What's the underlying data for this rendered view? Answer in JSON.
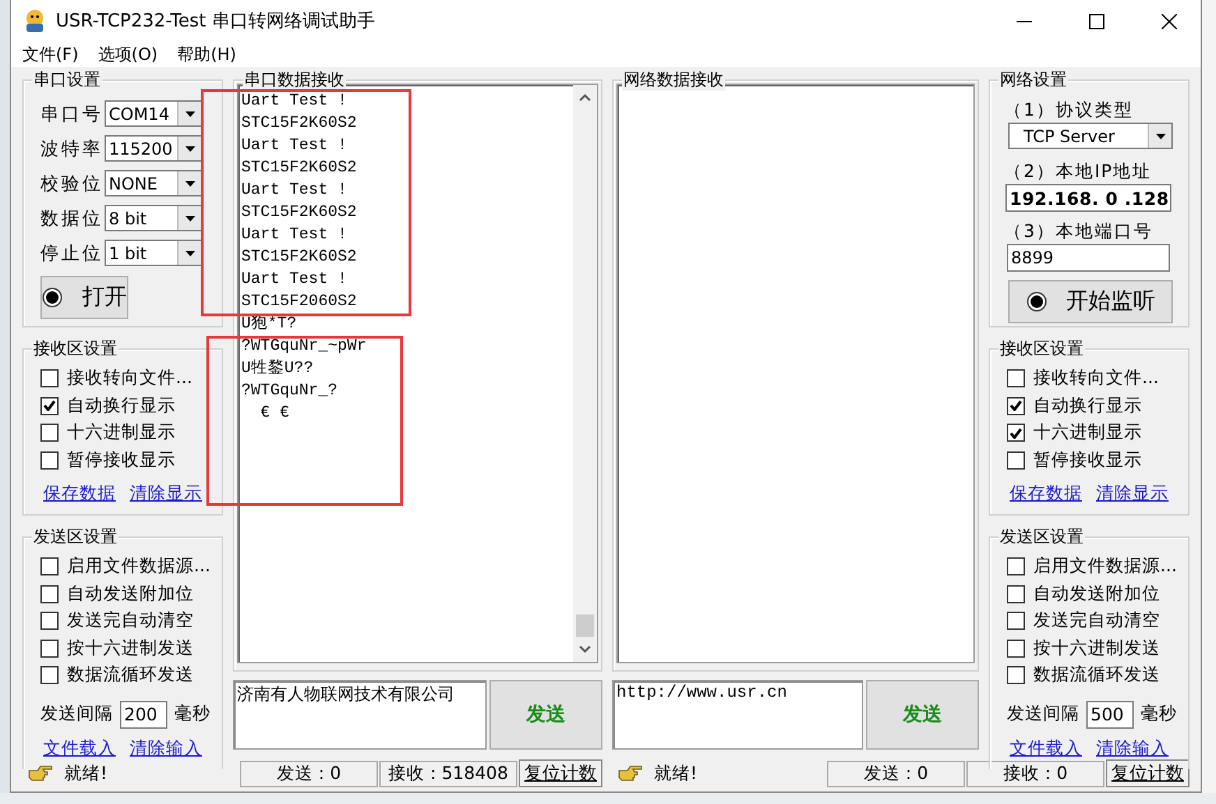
{
  "window": {
    "title": "USR-TCP232-Test 串口转网络调试助手"
  },
  "menu": [
    "文件(F)",
    "选项(O)",
    "帮助(H)"
  ],
  "serial_settings": {
    "title": "串口设置",
    "fields": [
      {
        "label": "串口号",
        "value": "COM14"
      },
      {
        "label": "波特率",
        "value": "115200"
      },
      {
        "label": "校验位",
        "value": "NONE"
      },
      {
        "label": "数据位",
        "value": "8 bit"
      },
      {
        "label": "停止位",
        "value": "1 bit"
      }
    ],
    "open_button": "打开"
  },
  "serial_receive": {
    "title": "串口数据接收",
    "lines": [
      "Uart Test !",
      "STC15F2K60S2",
      "Uart Test !",
      "STC15F2K60S2",
      "Uart Test !",
      "STC15F2K60S2",
      "Uart Test !",
      "STC15F2K60S2",
      "Uart Test !",
      "STC15F2060S2",
      "U狍*T?",
      "?WTGquNr_~pWr",
      "U牲鍪U??",
      "?WTGquNr_?",
      "  € €"
    ]
  },
  "serial_receive_settings": {
    "title": "接收区设置",
    "options": [
      {
        "label": "接收转向文件...",
        "checked": false
      },
      {
        "label": "自动换行显示",
        "checked": true
      },
      {
        "label": "十六进制显示",
        "checked": false
      },
      {
        "label": "暂停接收显示",
        "checked": false
      }
    ],
    "links": [
      "保存数据",
      "清除显示"
    ]
  },
  "serial_send_settings": {
    "title": "发送区设置",
    "options": [
      {
        "label": "启用文件数据源...",
        "checked": false
      },
      {
        "label": "自动发送附加位",
        "checked": false
      },
      {
        "label": "发送完自动清空",
        "checked": false
      },
      {
        "label": "按十六进制发送",
        "checked": false
      },
      {
        "label": "数据流循环发送",
        "checked": false
      }
    ],
    "interval_label": "发送间隔",
    "interval": "200",
    "unit": "毫秒",
    "links": [
      "文件载入",
      "清除输入"
    ]
  },
  "serial_send": {
    "text": "济南有人物联网技术有限公司",
    "button": "发送"
  },
  "serial_status": {
    "message": "就绪!",
    "sent": "发送 : 0",
    "received": "接收 : 518408",
    "reset": "复位计数"
  },
  "network_receive": {
    "title": "网络数据接收"
  },
  "network_send": {
    "text": "http://www.usr.cn",
    "button": "发送"
  },
  "network_status": {
    "message": "就绪!",
    "sent": "发送 : 0",
    "received": "接收 : 0",
    "reset": "复位计数"
  },
  "network_settings": {
    "title": "网络设置",
    "protocol_label": "（1）协议类型",
    "protocol": "TCP Server",
    "ip_label": "（2）本地IP地址",
    "ip": "192.168. 0 .128",
    "port_label": "（3）本地端口号",
    "port": "8899",
    "listen_button": "开始监听"
  },
  "network_receive_settings": {
    "title": "接收区设置",
    "options": [
      {
        "label": "接收转向文件...",
        "checked": false
      },
      {
        "label": "自动换行显示",
        "checked": true
      },
      {
        "label": "十六进制显示",
        "checked": true
      },
      {
        "label": "暂停接收显示",
        "checked": false
      }
    ],
    "links": [
      "保存数据",
      "清除显示"
    ]
  },
  "network_send_settings": {
    "title": "发送区设置",
    "options": [
      {
        "label": "启用文件数据源...",
        "checked": false
      },
      {
        "label": "自动发送附加位",
        "checked": false
      },
      {
        "label": "发送完自动清空",
        "checked": false
      },
      {
        "label": "按十六进制发送",
        "checked": false
      },
      {
        "label": "数据流循环发送",
        "checked": false
      }
    ],
    "interval_label": "发送间隔",
    "interval": "500",
    "unit": "毫秒",
    "links": [
      "文件载入",
      "清除输入"
    ]
  },
  "highlight_boxes": [
    {
      "color": "#e8383d"
    },
    {
      "color": "#e8383d"
    }
  ]
}
